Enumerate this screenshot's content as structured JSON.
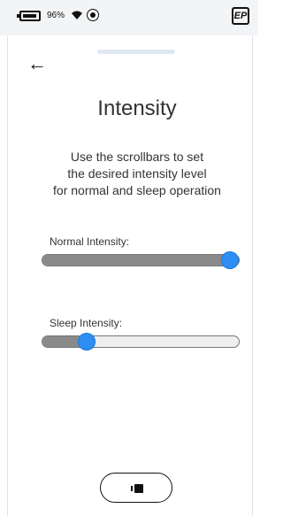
{
  "status_bar": {
    "battery_percent": 0.96,
    "battery_label": "96%",
    "wifi_icon": "wifi-icon",
    "status_icon": "circle-icon",
    "logo_text": "EP"
  },
  "header": {
    "back_icon": "arrow-left-icon",
    "back_text": "←"
  },
  "main": {
    "title": "Intensity",
    "instructions": "Use the scrollbars to set\nthe desired intensity level\nfor normal and sleep operation"
  },
  "settings": {
    "normal_label": "Normal Intensity:",
    "normal_value": 1.0,
    "sleep_label": "Sleep Intensity:",
    "sleep_value": 0.2
  },
  "footer": {
    "bottom_button_icon": "device-icon"
  },
  "colors": {
    "accent": "#2e8ef2",
    "track_fill": "#8a8a8a",
    "track_bg": "#eeeeee",
    "status_bg": "#f3f4f6"
  }
}
